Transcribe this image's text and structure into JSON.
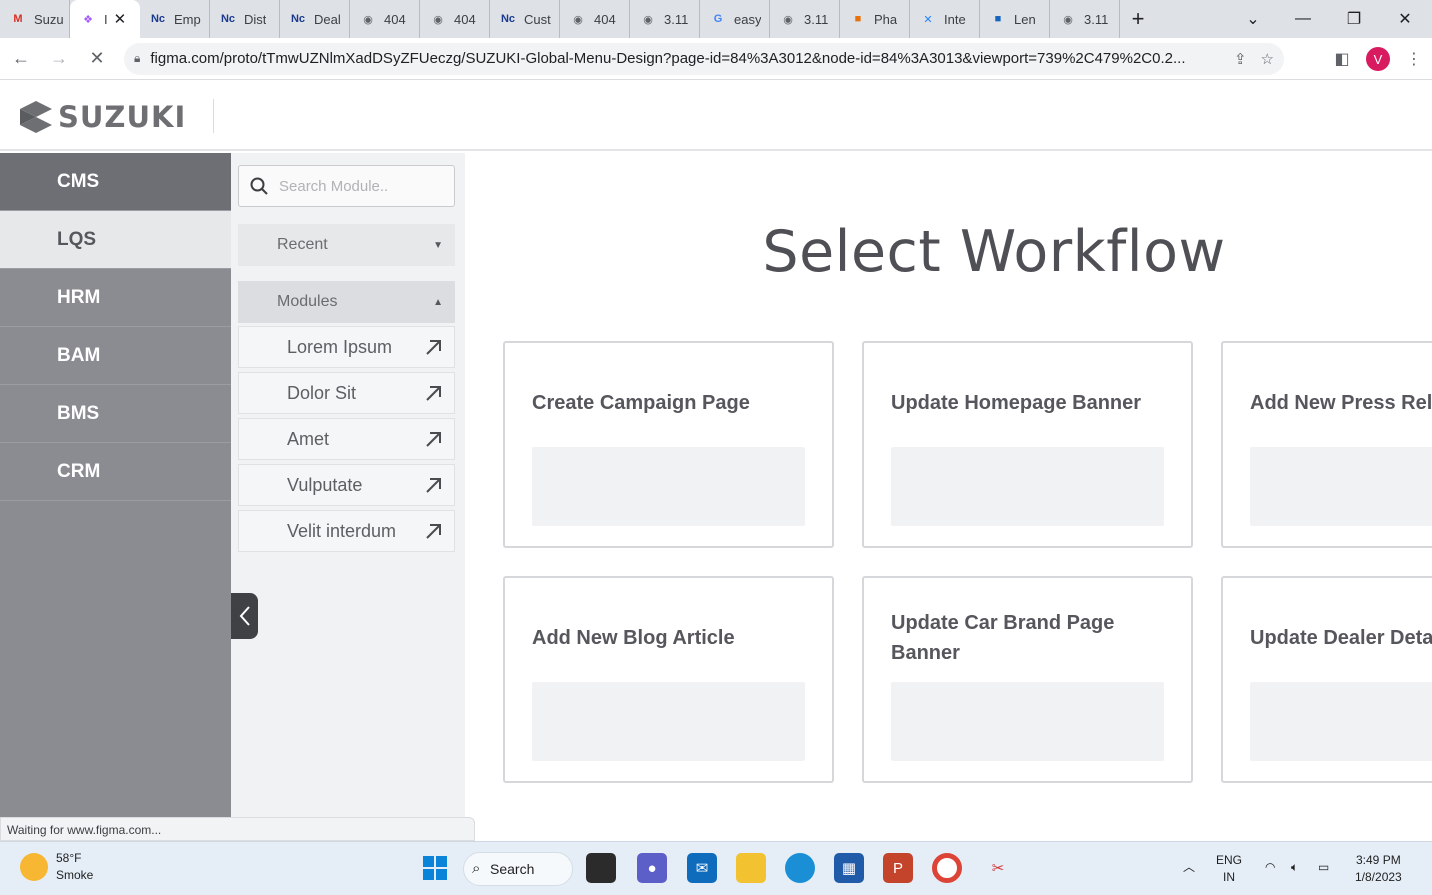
{
  "browser": {
    "tabs": [
      {
        "label": "Suzu",
        "icon": "gmail-icon",
        "color": "#d93025"
      },
      {
        "label": "I",
        "icon": "figma-icon",
        "color": "#a259ff",
        "active": true
      },
      {
        "label": "Emp",
        "icon": "nc-icon",
        "color": "#1a3a8f"
      },
      {
        "label": "Dist",
        "icon": "nc-icon",
        "color": "#1a3a8f"
      },
      {
        "label": "Deal",
        "icon": "nc-icon",
        "color": "#1a3a8f"
      },
      {
        "label": "404",
        "icon": "globe-icon",
        "color": "#5f6368"
      },
      {
        "label": "404",
        "icon": "globe-icon",
        "color": "#5f6368"
      },
      {
        "label": "Cust",
        "icon": "nc-icon",
        "color": "#1a3a8f"
      },
      {
        "label": "404",
        "icon": "globe-icon",
        "color": "#5f6368"
      },
      {
        "label": "3.11",
        "icon": "globe-icon",
        "color": "#5f6368"
      },
      {
        "label": "easy",
        "icon": "google-icon",
        "color": "#4285f4"
      },
      {
        "label": "3.11",
        "icon": "globe-icon",
        "color": "#5f6368"
      },
      {
        "label": "Pha",
        "icon": "app-icon",
        "color": "#e8710a"
      },
      {
        "label": "Inte",
        "icon": "confluence-icon",
        "color": "#2684ff"
      },
      {
        "label": "Len",
        "icon": "app-icon",
        "color": "#1565c0"
      },
      {
        "label": "3.11",
        "icon": "globe-icon",
        "color": "#5f6368"
      }
    ],
    "url": "figma.com/proto/tTmwUZNlmXadDSyZFUeczg/SUZUKI-Global-Menu-Design?page-id=84%3A3012&node-id=84%3A3013&viewport=739%2C479%2C0.2...",
    "profile_initial": "V",
    "status_text": "Waiting for www.figma.com..."
  },
  "app": {
    "brand": "SUZUKI",
    "rail": [
      {
        "label": "CMS",
        "state": "active"
      },
      {
        "label": "LQS",
        "state": "light"
      },
      {
        "label": "HRM",
        "state": ""
      },
      {
        "label": "BAM",
        "state": ""
      },
      {
        "label": "BMS",
        "state": ""
      },
      {
        "label": "CRM",
        "state": ""
      }
    ],
    "search_placeholder": "Search Module..",
    "recent_label": "Recent",
    "modules_label": "Modules",
    "modules": [
      "Lorem Ipsum",
      "Dolor Sit",
      "Amet",
      "Vulputate",
      "Velit interdum"
    ],
    "title": "Select Workflow",
    "workflows": [
      {
        "title": "Create Campaign Page"
      },
      {
        "title": "Update Homepage Banner"
      },
      {
        "title": "Add New Press Release"
      },
      {
        "title": "Add New Blog Article"
      },
      {
        "title": "Update Car Brand Page Banner"
      },
      {
        "title": "Update Dealer Details"
      }
    ]
  },
  "taskbar": {
    "weather_temp": "58°F",
    "weather_desc": "Smoke",
    "search_label": "Search",
    "lang_top": "ENG",
    "lang_bottom": "IN",
    "time": "3:49 PM",
    "date": "1/8/2023"
  },
  "colors": {
    "rail_bg": "#8a8c91",
    "rail_active": "#6d6f74",
    "panel_bg": "#f1f2f4",
    "title_text": "#4e5055",
    "avatar": "#d81b60"
  }
}
